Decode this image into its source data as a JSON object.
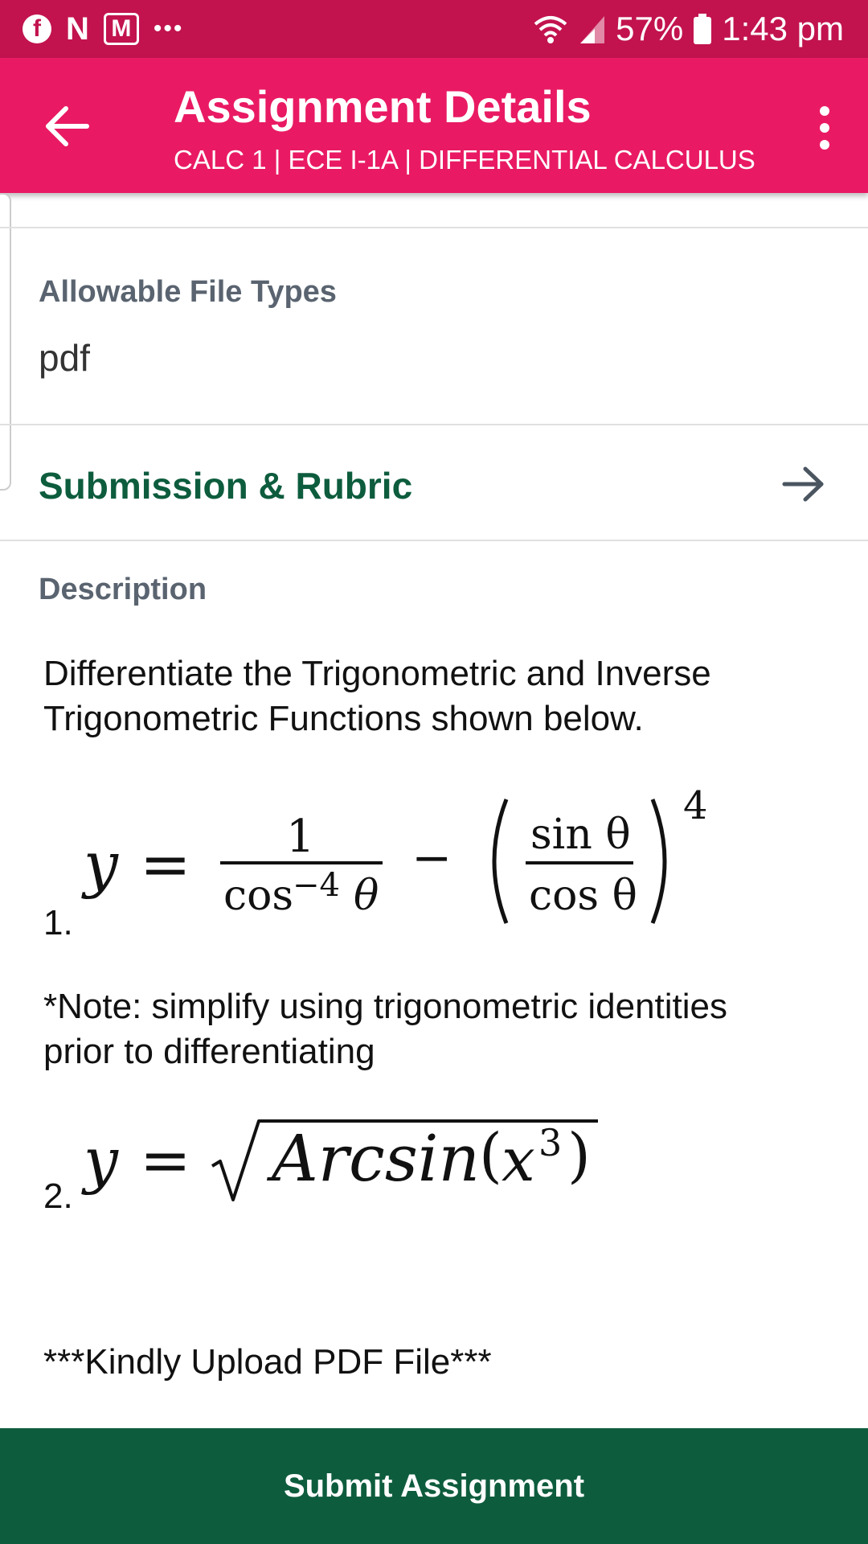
{
  "status_bar": {
    "left_icons": [
      "facebook-icon",
      "n-app-icon",
      "m-app-icon",
      "more-notifications-icon"
    ],
    "battery": "57%",
    "time": "1:43 pm"
  },
  "app_bar": {
    "title": "Assignment Details",
    "subtitle": "CALC 1 | ECE I-1A | DIFFERENTIAL CALCULUS"
  },
  "file_types": {
    "label": "Allowable File Types",
    "value": "pdf"
  },
  "submission": {
    "label": "Submission & Rubric"
  },
  "description": {
    "label": "Description",
    "intro_line1": "Differentiate the Trigonometric and Inverse",
    "intro_line2": "Trigonometric Functions shown below.",
    "item1_number": "1.",
    "note_line1": "*Note: simplify using trigonometric identities",
    "note_line2": "prior to differentiating",
    "item2_number": "2.",
    "upload_note": "***Kindly Upload PDF File***"
  },
  "formula1": {
    "y": "y",
    "eq": "=",
    "num": "1",
    "den_cos": "cos",
    "den_exp": "−4",
    "den_theta": "θ",
    "minus": "−",
    "frac_num": "sin θ",
    "frac_den": "cos θ",
    "power": "4"
  },
  "formula2": {
    "y": "y",
    "eq": "=",
    "arcsin": "Arcsin",
    "arg_open": "(",
    "arg_x": "x",
    "arg_exp": "3",
    "arg_close": ")"
  },
  "submit_button": {
    "label": "Submit Assignment"
  },
  "colors": {
    "status_bar": "#c2134f",
    "app_bar": "#e91a63",
    "accent_green": "#0d5c3e",
    "submit_bg": "#0e5c3e"
  }
}
